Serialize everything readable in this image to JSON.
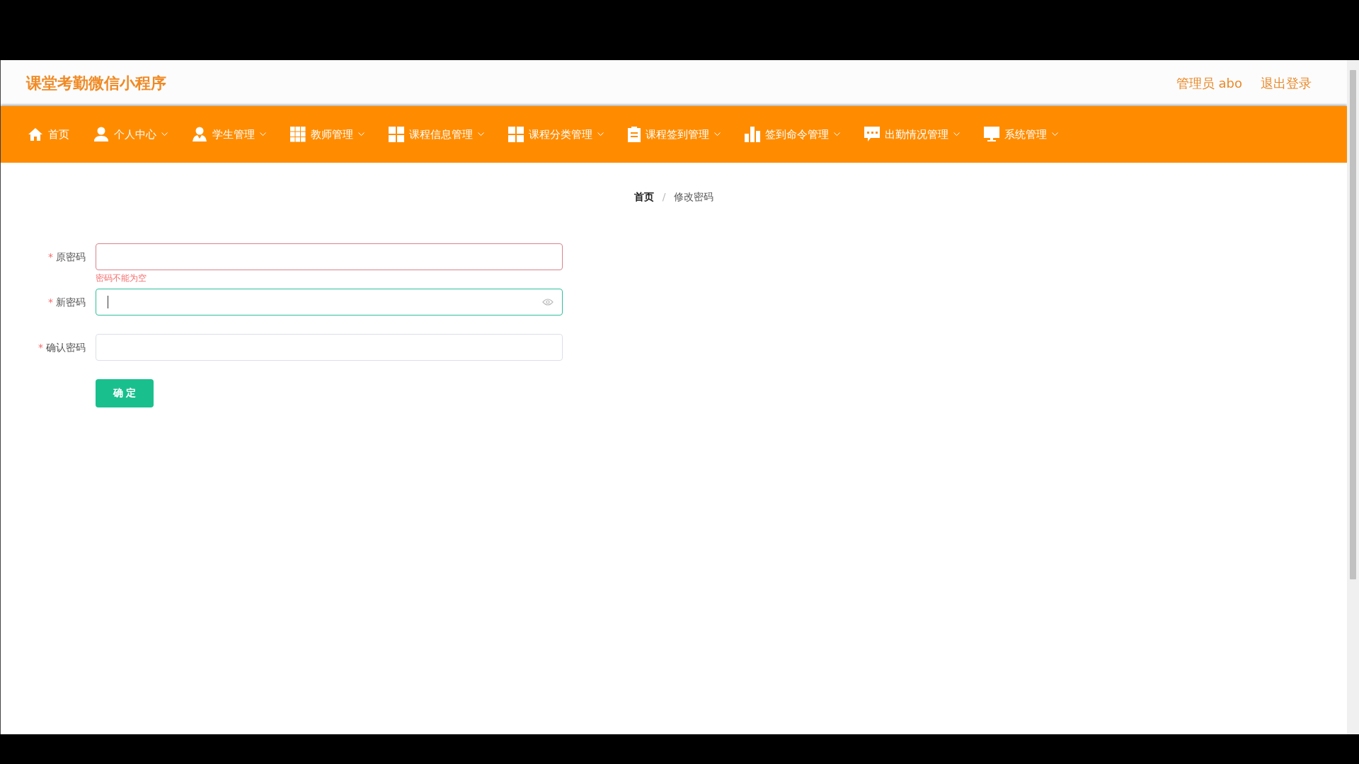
{
  "header": {
    "title": "课堂考勤微信小程序",
    "user": "管理员 abo",
    "logout": "退出登录"
  },
  "nav": [
    {
      "label": "首页",
      "kind": "home",
      "dropdown": false
    },
    {
      "label": "个人中心",
      "kind": "person",
      "dropdown": true
    },
    {
      "label": "学生管理",
      "kind": "student",
      "dropdown": true
    },
    {
      "label": "教师管理",
      "kind": "grid9",
      "dropdown": true
    },
    {
      "label": "课程信息管理",
      "kind": "grid4",
      "dropdown": true
    },
    {
      "label": "课程分类管理",
      "kind": "grid4",
      "dropdown": true
    },
    {
      "label": "课程签到管理",
      "kind": "clipboard",
      "dropdown": true
    },
    {
      "label": "签到命令管理",
      "kind": "chart",
      "dropdown": true
    },
    {
      "label": "出勤情况管理",
      "kind": "chat",
      "dropdown": true
    },
    {
      "label": "系统管理",
      "kind": "monitor",
      "dropdown": true
    }
  ],
  "breadcrumb": {
    "separator": "/",
    "items": [
      "首页",
      "修改密码"
    ]
  },
  "form": {
    "fields": [
      {
        "marker": "*",
        "label": "原密码",
        "invalid": true,
        "focused": false,
        "error": "密码不能为空",
        "eye": false
      },
      {
        "marker": "*",
        "label": "新密码",
        "invalid": false,
        "focused": true,
        "eye": true
      },
      {
        "marker": "*",
        "label": "确认密码",
        "invalid": false,
        "focused": false,
        "eye": false
      }
    ],
    "submit": "确 定"
  }
}
